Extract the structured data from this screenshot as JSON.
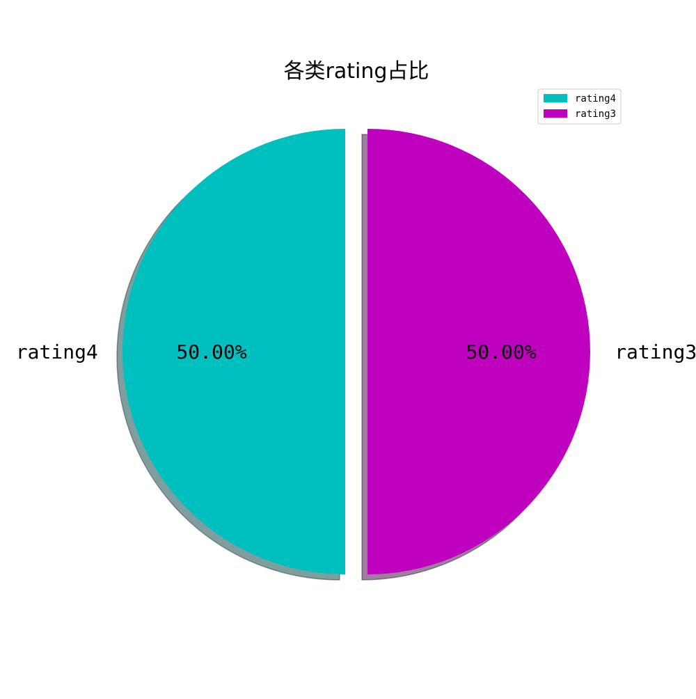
{
  "chart_data": {
    "type": "pie",
    "title": "各类rating占比",
    "slices": [
      {
        "label": "rating4",
        "value": 50.0,
        "percent_label": "50.00%",
        "color": "#00bfbf",
        "shadow_color": "#7f9f9f"
      },
      {
        "label": "rating3",
        "value": 50.0,
        "percent_label": "50.00%",
        "color": "#bf00bf",
        "shadow_color": "#9f7f9f"
      }
    ],
    "exploded": true,
    "shadow": true,
    "legend": {
      "placement": "top-right",
      "entries": [
        "rating4",
        "rating3"
      ]
    }
  }
}
